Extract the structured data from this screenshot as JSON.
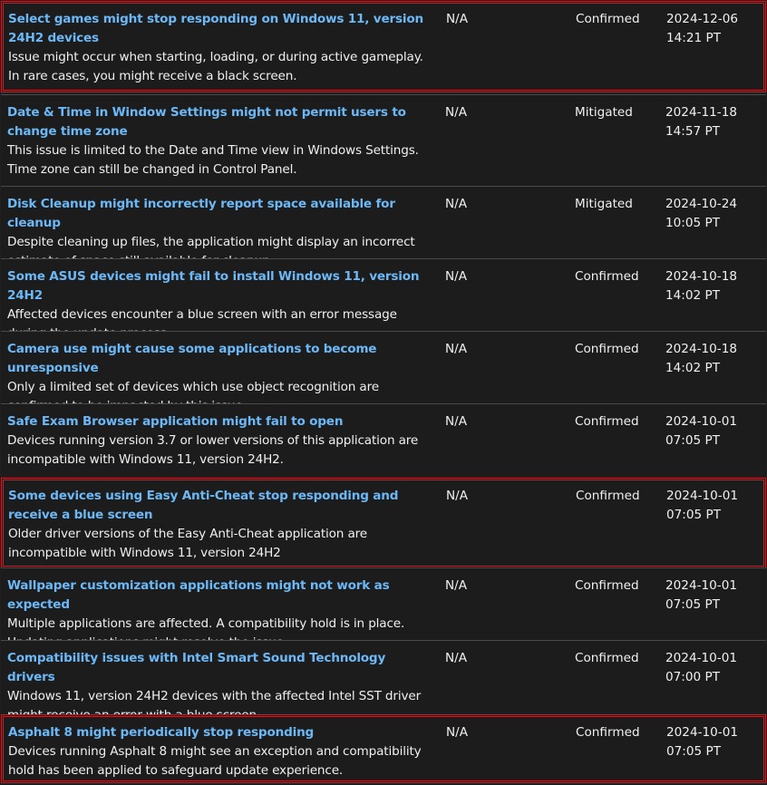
{
  "rows": [
    {
      "title": "Select games might stop responding on Windows 11, version 24H2 devices",
      "description": "Issue might occur when starting, loading, or during active gameplay. In rare cases, you might receive a black screen.",
      "originating_update": "N/A",
      "status": "Confirmed",
      "date": "2024-12-06",
      "time": "14:21 PT",
      "highlighted": true
    },
    {
      "title": "Date & Time in Window Settings might not permit users to change time zone",
      "description": "This issue is limited to the Date and Time view in Windows Settings. Time zone can still be changed in Control Panel.",
      "originating_update": "N/A",
      "status": "Mitigated",
      "date": "2024-11-18",
      "time": "14:57 PT",
      "highlighted": false
    },
    {
      "title": "Disk Cleanup might incorrectly report space available for cleanup",
      "description": "Despite cleaning up files, the application might display an incorrect estimate of space still available for cleanup",
      "originating_update": "N/A",
      "status": "Mitigated",
      "date": "2024-10-24",
      "time": "10:05 PT",
      "highlighted": false
    },
    {
      "title": "Some ASUS devices might fail to install Windows 11, version 24H2",
      "description": "Affected devices encounter a blue screen with an error message during the update process",
      "originating_update": "N/A",
      "status": "Confirmed",
      "date": "2024-10-18",
      "time": "14:02 PT",
      "highlighted": false
    },
    {
      "title": "Camera use might cause some applications to become unresponsive",
      "description": "Only a limited set of devices which use object recognition are confirmed to be impacted by this issue",
      "originating_update": "N/A",
      "status": "Confirmed",
      "date": "2024-10-18",
      "time": "14:02 PT",
      "highlighted": false
    },
    {
      "title": "Safe Exam Browser application might fail to open",
      "description": "Devices running version 3.7 or lower versions of this application are incompatible with Windows 11, version 24H2.",
      "originating_update": "N/A",
      "status": "Confirmed",
      "date": "2024-10-01",
      "time": "07:05 PT",
      "highlighted": false
    },
    {
      "title": "Some devices using Easy Anti-Cheat stop responding and receive a blue screen",
      "description": "Older driver versions of the Easy Anti-Cheat application are incompatible with Windows 11, version 24H2",
      "originating_update": "N/A",
      "status": "Confirmed",
      "date": "2024-10-01",
      "time": "07:05 PT",
      "highlighted": true
    },
    {
      "title": "Wallpaper customization applications might not work as expected",
      "description": "Multiple applications are affected. A compatibility hold is in place. Updating applications might resolve the issue.",
      "originating_update": "N/A",
      "status": "Confirmed",
      "date": "2024-10-01",
      "time": "07:05 PT",
      "highlighted": false
    },
    {
      "title": "Compatibility issues with Intel Smart Sound Technology drivers",
      "description": "Windows 11, version 24H2 devices with the affected Intel SST driver might receive an error with a blue screen.",
      "originating_update": "N/A",
      "status": "Confirmed",
      "date": "2024-10-01",
      "time": "07:00 PT",
      "highlighted": false
    },
    {
      "title": "Asphalt 8 might periodically stop responding",
      "description": "Devices running Asphalt 8 might see an exception and compatibility hold has been applied to safeguard update experience.",
      "originating_update": "N/A",
      "status": "Confirmed",
      "date": "2024-10-01",
      "time": "07:05 PT",
      "highlighted": true
    }
  ],
  "colors": {
    "background": "#1c1c1c",
    "link": "#6cb8f6",
    "text": "#f0f0f0",
    "highlight_border": "#e0141e",
    "row_divider": "#4a4a4a"
  }
}
